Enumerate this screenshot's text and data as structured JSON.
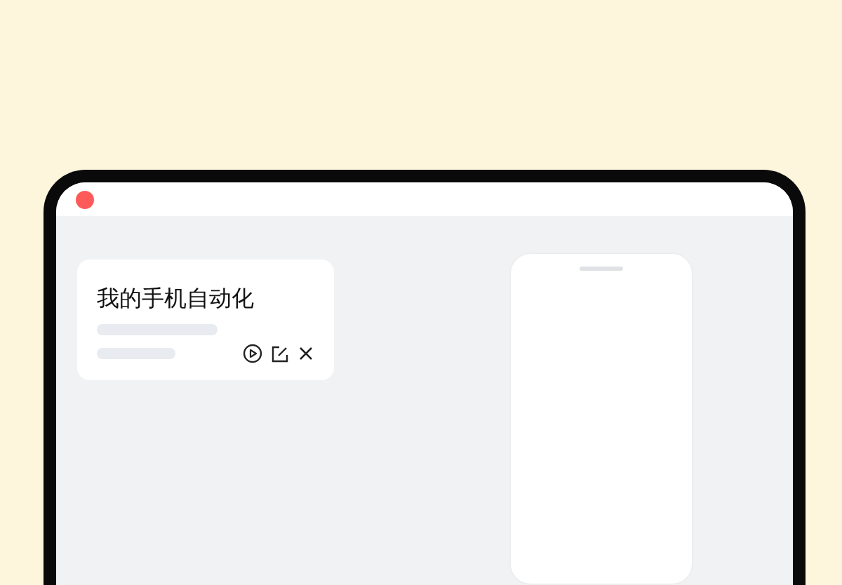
{
  "card": {
    "title": "我的手机自动化"
  }
}
